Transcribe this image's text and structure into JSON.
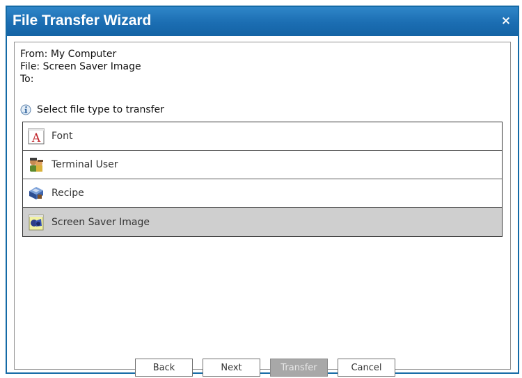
{
  "window": {
    "title": "File Transfer Wizard",
    "close_glyph": "×",
    "close_icon": "close-icon"
  },
  "transfer_info": {
    "from": "From: My Computer",
    "file": "File: Screen Saver Image",
    "to": "To:"
  },
  "prompt": {
    "icon": "info-icon",
    "text": "Select file type to transfer"
  },
  "file_types": [
    {
      "label": "Font",
      "icon": "font-icon",
      "selected": false
    },
    {
      "label": "Terminal User",
      "icon": "terminal-user-icon",
      "selected": false
    },
    {
      "label": "Recipe",
      "icon": "recipe-icon",
      "selected": false
    },
    {
      "label": "Screen Saver Image",
      "icon": "screen-saver-image-icon",
      "selected": true
    }
  ],
  "buttons": {
    "back": "Back",
    "next": "Next",
    "transfer": "Transfer",
    "cancel": "Cancel"
  },
  "colors": {
    "titlebar": "#1b6db2",
    "selected_row": "#cfcfcf",
    "disabled_button": "#a8a8a8"
  }
}
